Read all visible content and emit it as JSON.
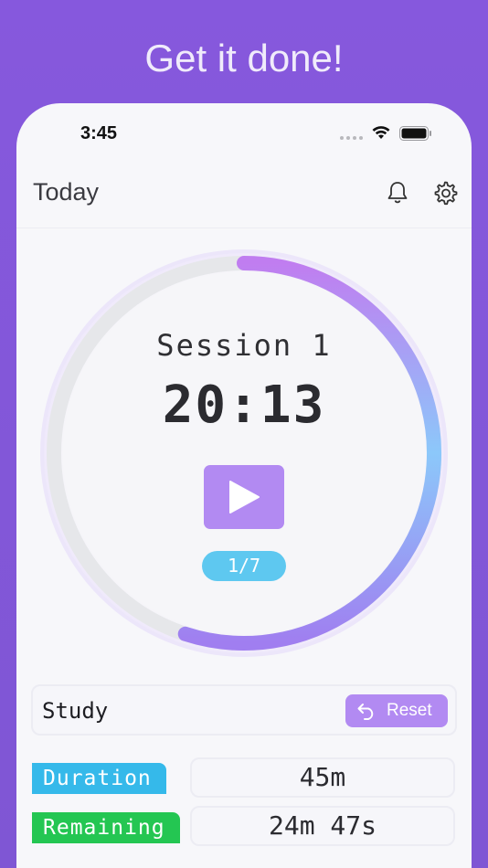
{
  "banner": {
    "text": "Get it done!"
  },
  "status_bar": {
    "time": "3:45"
  },
  "nav": {
    "title": "Today",
    "icons": [
      "bell-icon",
      "gear-icon"
    ]
  },
  "timer": {
    "session_label": "Session 1",
    "clock": "20:13",
    "counter": "1/7",
    "progress": 0.55,
    "colors": {
      "track": "#e6e7ea",
      "start": "#c07df0",
      "end": "#8cd4f8"
    }
  },
  "task": {
    "name": "Study",
    "reset_label": "Reset"
  },
  "stats": {
    "duration_label": "Duration",
    "duration_value": "45m",
    "remaining_label": "Remaining",
    "remaining_value": "24m 47s"
  },
  "colors": {
    "background": "#8658dd",
    "accent": "#b28af2",
    "duration": "#35b9ea",
    "remaining": "#24c652"
  }
}
